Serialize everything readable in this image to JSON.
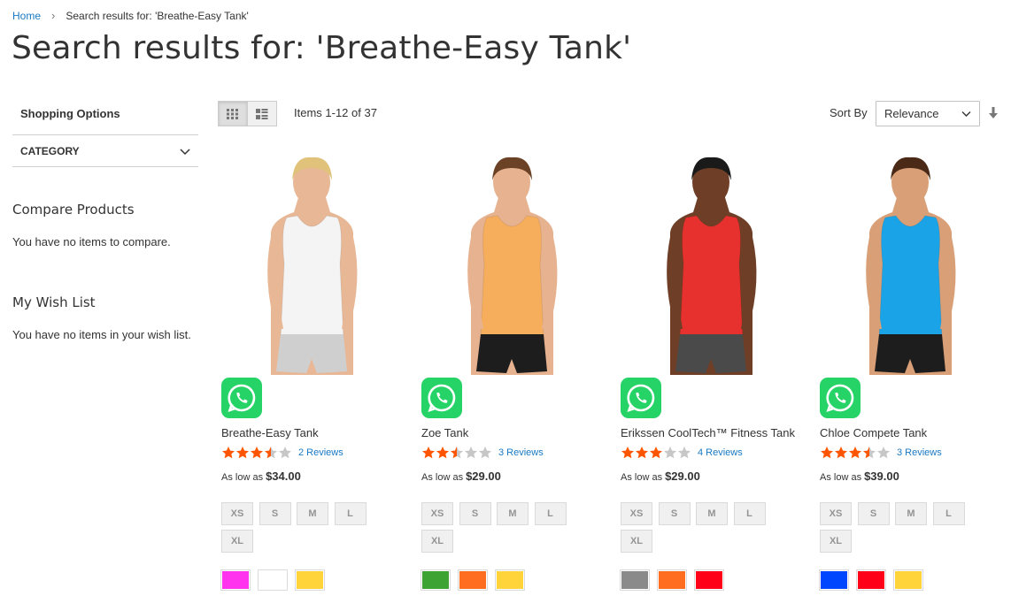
{
  "breadcrumb": {
    "home": "Home",
    "current": "Search results for: 'Breathe-Easy Tank'"
  },
  "page_title": "Search results for: 'Breathe-Easy Tank'",
  "sidebar": {
    "shopping_options": "Shopping Options",
    "category_filter": "CATEGORY",
    "compare_title": "Compare Products",
    "compare_text": "You have no items to compare.",
    "wishlist_title": "My Wish List",
    "wishlist_text": "You have no items in your wish list."
  },
  "toolbar": {
    "amount": "Items 1-12 of 37",
    "sort_label": "Sort By",
    "sort_value": "Relevance",
    "mode_grid_icon": "grid-icon",
    "mode_list_icon": "list-icon"
  },
  "colors": {
    "link": "#1979c3",
    "star_filled": "#ff5501",
    "star_empty": "#c7c7c7",
    "whatsapp": "#25d366"
  },
  "products": [
    {
      "name": "Breathe-Easy Tank",
      "rating": 3.5,
      "reviews": "2 Reviews",
      "price_label": "As low as",
      "price": "$34.00",
      "sizes": [
        "XS",
        "S",
        "M",
        "L",
        "XL"
      ],
      "swatches": [
        "#ff33ee",
        "#ffffff",
        "#ffd43a"
      ],
      "image": {
        "tank": "#f4f4f4",
        "shorts": "#cfcfcf",
        "skin": "#e8b896",
        "hair": "#e0c27a"
      }
    },
    {
      "name": "Zoe Tank",
      "rating": 2.5,
      "reviews": "3 Reviews",
      "price_label": "As low as",
      "price": "$29.00",
      "sizes": [
        "XS",
        "S",
        "M",
        "L",
        "XL"
      ],
      "swatches": [
        "#3da433",
        "#ff6d21",
        "#ffd43a"
      ],
      "image": {
        "tank": "#f7ae5c",
        "shorts": "#1d1d1d",
        "skin": "#e6b290",
        "hair": "#6b4226"
      }
    },
    {
      "name": "Erikssen CoolTech™ Fitness Tank",
      "rating": 3,
      "reviews": "4 Reviews",
      "price_label": "As low as",
      "price": "$29.00",
      "sizes": [
        "XS",
        "S",
        "M",
        "L",
        "XL"
      ],
      "swatches": [
        "#8a8a8a",
        "#ff6d21",
        "#ff0019"
      ],
      "image": {
        "tank": "#e6312e",
        "shorts": "#4a4a4a",
        "skin": "#6e3f26",
        "hair": "#1a1a1a"
      }
    },
    {
      "name": "Chloe Compete Tank",
      "rating": 3.5,
      "reviews": "3 Reviews",
      "price_label": "As low as",
      "price": "$39.00",
      "sizes": [
        "XS",
        "S",
        "M",
        "L",
        "XL"
      ],
      "swatches": [
        "#0046ff",
        "#ff0019",
        "#ffd43a"
      ],
      "image": {
        "tank": "#1ba3e8",
        "shorts": "#1d1d1d",
        "skin": "#d9a078",
        "hair": "#4a2a16"
      }
    }
  ]
}
